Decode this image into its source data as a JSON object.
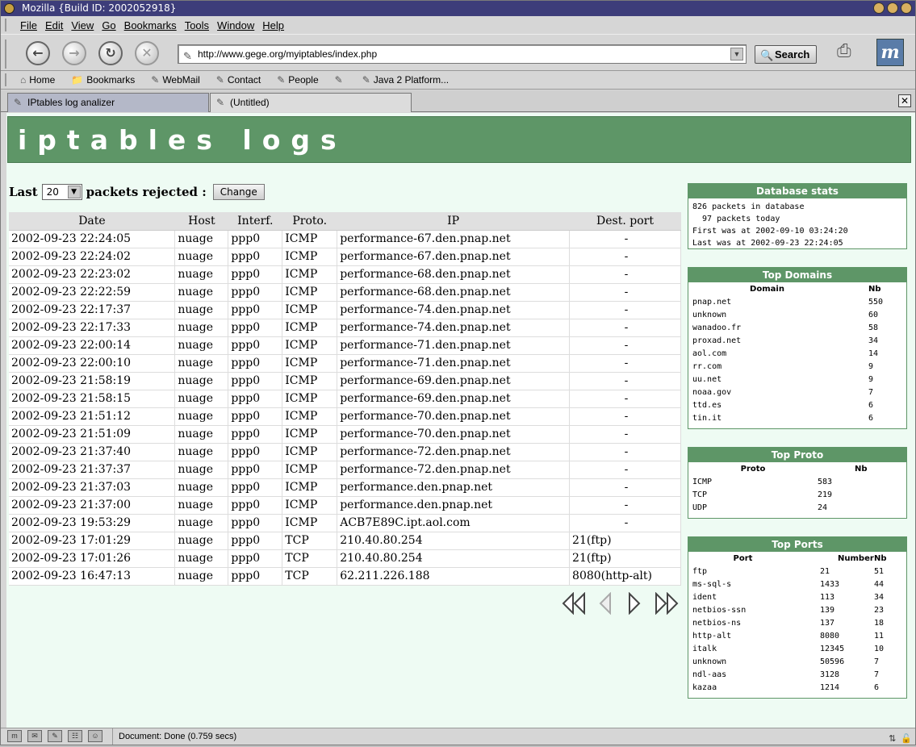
{
  "window": {
    "title": "Mozilla {Build ID: 2002052918}"
  },
  "menu": [
    "File",
    "Edit",
    "View",
    "Go",
    "Bookmarks",
    "Tools",
    "Window",
    "Help"
  ],
  "nav": {
    "back_icon": "back-arrow-icon",
    "url": "http://www.gege.org/myiptables/index.php",
    "search_label": "Search"
  },
  "personal_toolbar": [
    "Home",
    "Bookmarks",
    "WebMail",
    "Contact",
    "People",
    "",
    "Java 2 Platform..."
  ],
  "tabs": [
    {
      "label": "IPtables log analizer",
      "active": false
    },
    {
      "label": "(Untitled)",
      "active": true
    }
  ],
  "page": {
    "banner": "iptables logs",
    "form": {
      "prefix": "Last",
      "selected": "20",
      "suffix": "packets rejected :",
      "button": "Change"
    },
    "table": {
      "headers": [
        "Date",
        "Host",
        "Interf.",
        "Proto.",
        "IP",
        "Dest. port"
      ],
      "rows": [
        [
          "2002-09-23 22:24:05",
          "nuage",
          "ppp0",
          "ICMP",
          "performance-67.den.pnap.net",
          "-"
        ],
        [
          "2002-09-23 22:24:02",
          "nuage",
          "ppp0",
          "ICMP",
          "performance-67.den.pnap.net",
          "-"
        ],
        [
          "2002-09-23 22:23:02",
          "nuage",
          "ppp0",
          "ICMP",
          "performance-68.den.pnap.net",
          "-"
        ],
        [
          "2002-09-23 22:22:59",
          "nuage",
          "ppp0",
          "ICMP",
          "performance-68.den.pnap.net",
          "-"
        ],
        [
          "2002-09-23 22:17:37",
          "nuage",
          "ppp0",
          "ICMP",
          "performance-74.den.pnap.net",
          "-"
        ],
        [
          "2002-09-23 22:17:33",
          "nuage",
          "ppp0",
          "ICMP",
          "performance-74.den.pnap.net",
          "-"
        ],
        [
          "2002-09-23 22:00:14",
          "nuage",
          "ppp0",
          "ICMP",
          "performance-71.den.pnap.net",
          "-"
        ],
        [
          "2002-09-23 22:00:10",
          "nuage",
          "ppp0",
          "ICMP",
          "performance-71.den.pnap.net",
          "-"
        ],
        [
          "2002-09-23 21:58:19",
          "nuage",
          "ppp0",
          "ICMP",
          "performance-69.den.pnap.net",
          "-"
        ],
        [
          "2002-09-23 21:58:15",
          "nuage",
          "ppp0",
          "ICMP",
          "performance-69.den.pnap.net",
          "-"
        ],
        [
          "2002-09-23 21:51:12",
          "nuage",
          "ppp0",
          "ICMP",
          "performance-70.den.pnap.net",
          "-"
        ],
        [
          "2002-09-23 21:51:09",
          "nuage",
          "ppp0",
          "ICMP",
          "performance-70.den.pnap.net",
          "-"
        ],
        [
          "2002-09-23 21:37:40",
          "nuage",
          "ppp0",
          "ICMP",
          "performance-72.den.pnap.net",
          "-"
        ],
        [
          "2002-09-23 21:37:37",
          "nuage",
          "ppp0",
          "ICMP",
          "performance-72.den.pnap.net",
          "-"
        ],
        [
          "2002-09-23 21:37:03",
          "nuage",
          "ppp0",
          "ICMP",
          "performance.den.pnap.net",
          "-"
        ],
        [
          "2002-09-23 21:37:00",
          "nuage",
          "ppp0",
          "ICMP",
          "performance.den.pnap.net",
          "-"
        ],
        [
          "2002-09-23 19:53:29",
          "nuage",
          "ppp0",
          "ICMP",
          "ACB7E89C.ipt.aol.com",
          "-"
        ],
        [
          "2002-09-23 17:01:29",
          "nuage",
          "ppp0",
          "TCP",
          "210.40.80.254",
          "21(ftp)"
        ],
        [
          "2002-09-23 17:01:26",
          "nuage",
          "ppp0",
          "TCP",
          "210.40.80.254",
          "21(ftp)"
        ],
        [
          "2002-09-23 16:47:13",
          "nuage",
          "ppp0",
          "TCP",
          "62.211.226.188",
          "8080(http-alt)"
        ]
      ]
    },
    "db_stats": {
      "title": "Database stats",
      "lines": [
        "826 packets in database",
        "  97 packets today",
        "First was at 2002-09-10 03:24:20",
        "Last was at 2002-09-23 22:24:05"
      ]
    },
    "top_domains": {
      "title": "Top Domains",
      "headers": [
        "Domain",
        "Nb"
      ],
      "rows": [
        [
          "pnap.net",
          "550"
        ],
        [
          "unknown",
          "60"
        ],
        [
          "wanadoo.fr",
          "58"
        ],
        [
          "proxad.net",
          "34"
        ],
        [
          "aol.com",
          "14"
        ],
        [
          "rr.com",
          "9"
        ],
        [
          "uu.net",
          "9"
        ],
        [
          "noaa.gov",
          "7"
        ],
        [
          "ttd.es",
          "6"
        ],
        [
          "tin.it",
          "6"
        ]
      ]
    },
    "top_proto": {
      "title": "Top Proto",
      "headers": [
        "Proto",
        "Nb"
      ],
      "rows": [
        [
          "ICMP",
          "583"
        ],
        [
          "TCP",
          "219"
        ],
        [
          "UDP",
          "24"
        ]
      ]
    },
    "top_ports": {
      "title": "Top Ports",
      "headers": [
        "Port",
        "Number",
        "Nb"
      ],
      "rows": [
        [
          "ftp",
          "21",
          "51"
        ],
        [
          "ms-sql-s",
          "1433",
          "44"
        ],
        [
          "ident",
          "113",
          "34"
        ],
        [
          "netbios-ssn",
          "139",
          "23"
        ],
        [
          "netbios-ns",
          "137",
          "18"
        ],
        [
          "http-alt",
          "8080",
          "11"
        ],
        [
          "italk",
          "12345",
          "10"
        ],
        [
          "unknown",
          "50596",
          "7"
        ],
        [
          "ndl-aas",
          "3128",
          "7"
        ],
        [
          "kazaa",
          "1214",
          "6"
        ]
      ]
    }
  },
  "status": {
    "message": "Document: Done (0.759 secs)"
  }
}
